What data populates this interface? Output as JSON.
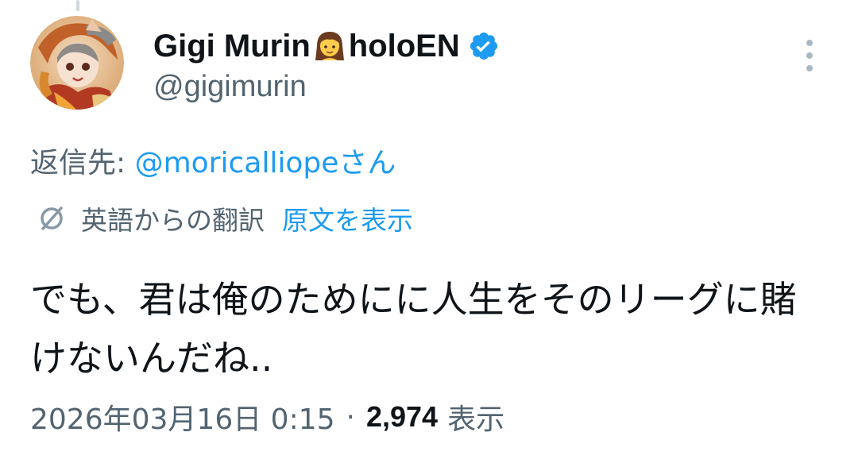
{
  "tweet": {
    "author": {
      "display_name": "Gigi Murin",
      "display_name_suffix": "holoEN",
      "name_emoji": "woman-emoji",
      "handle": "@gigimurin",
      "verified": true,
      "verified_color": "#1d9bf0"
    },
    "reply_to": {
      "prefix": "返信先: ",
      "mention": "@moricalliope",
      "suffix": "さん"
    },
    "translation": {
      "label": "英語からの翻訳",
      "show_original": "原文を表示",
      "icon": "globe-icon"
    },
    "text": "でも、君は俺のためにに人生をそのリーグに賭けないんだね..",
    "timestamp": "2026年03月16日 0:15",
    "separator": "·",
    "view_count": "2,974",
    "view_label": "表示"
  },
  "colors": {
    "text_primary": "#0f1419",
    "text_secondary": "#536471",
    "link": "#1d9bf0"
  }
}
